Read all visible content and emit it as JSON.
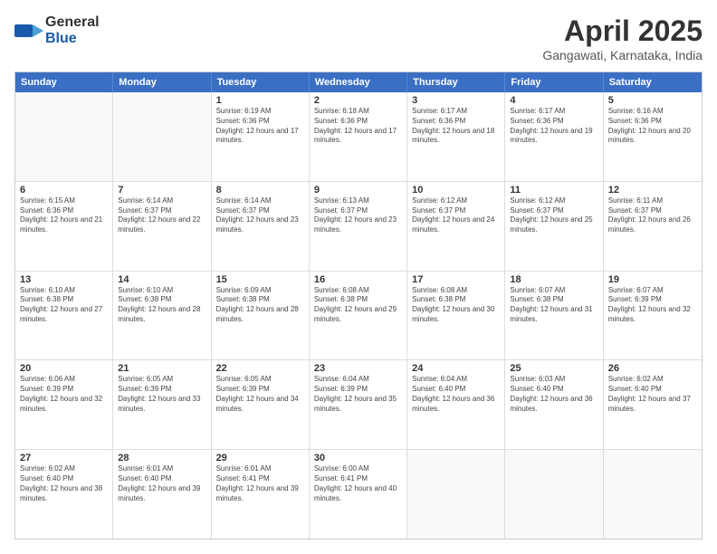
{
  "header": {
    "logo_general": "General",
    "logo_blue": "Blue",
    "month": "April 2025",
    "location": "Gangawati, Karnataka, India"
  },
  "days_of_week": [
    "Sunday",
    "Monday",
    "Tuesday",
    "Wednesday",
    "Thursday",
    "Friday",
    "Saturday"
  ],
  "weeks": [
    [
      {
        "day": "",
        "info": ""
      },
      {
        "day": "",
        "info": ""
      },
      {
        "day": "1",
        "info": "Sunrise: 6:19 AM\nSunset: 6:36 PM\nDaylight: 12 hours and 17 minutes."
      },
      {
        "day": "2",
        "info": "Sunrise: 6:18 AM\nSunset: 6:36 PM\nDaylight: 12 hours and 17 minutes."
      },
      {
        "day": "3",
        "info": "Sunrise: 6:17 AM\nSunset: 6:36 PM\nDaylight: 12 hours and 18 minutes."
      },
      {
        "day": "4",
        "info": "Sunrise: 6:17 AM\nSunset: 6:36 PM\nDaylight: 12 hours and 19 minutes."
      },
      {
        "day": "5",
        "info": "Sunrise: 6:16 AM\nSunset: 6:36 PM\nDaylight: 12 hours and 20 minutes."
      }
    ],
    [
      {
        "day": "6",
        "info": "Sunrise: 6:15 AM\nSunset: 6:36 PM\nDaylight: 12 hours and 21 minutes."
      },
      {
        "day": "7",
        "info": "Sunrise: 6:14 AM\nSunset: 6:37 PM\nDaylight: 12 hours and 22 minutes."
      },
      {
        "day": "8",
        "info": "Sunrise: 6:14 AM\nSunset: 6:37 PM\nDaylight: 12 hours and 23 minutes."
      },
      {
        "day": "9",
        "info": "Sunrise: 6:13 AM\nSunset: 6:37 PM\nDaylight: 12 hours and 23 minutes."
      },
      {
        "day": "10",
        "info": "Sunrise: 6:12 AM\nSunset: 6:37 PM\nDaylight: 12 hours and 24 minutes."
      },
      {
        "day": "11",
        "info": "Sunrise: 6:12 AM\nSunset: 6:37 PM\nDaylight: 12 hours and 25 minutes."
      },
      {
        "day": "12",
        "info": "Sunrise: 6:11 AM\nSunset: 6:37 PM\nDaylight: 12 hours and 26 minutes."
      }
    ],
    [
      {
        "day": "13",
        "info": "Sunrise: 6:10 AM\nSunset: 6:38 PM\nDaylight: 12 hours and 27 minutes."
      },
      {
        "day": "14",
        "info": "Sunrise: 6:10 AM\nSunset: 6:38 PM\nDaylight: 12 hours and 28 minutes."
      },
      {
        "day": "15",
        "info": "Sunrise: 6:09 AM\nSunset: 6:38 PM\nDaylight: 12 hours and 28 minutes."
      },
      {
        "day": "16",
        "info": "Sunrise: 6:08 AM\nSunset: 6:38 PM\nDaylight: 12 hours and 29 minutes."
      },
      {
        "day": "17",
        "info": "Sunrise: 6:08 AM\nSunset: 6:38 PM\nDaylight: 12 hours and 30 minutes."
      },
      {
        "day": "18",
        "info": "Sunrise: 6:07 AM\nSunset: 6:38 PM\nDaylight: 12 hours and 31 minutes."
      },
      {
        "day": "19",
        "info": "Sunrise: 6:07 AM\nSunset: 6:39 PM\nDaylight: 12 hours and 32 minutes."
      }
    ],
    [
      {
        "day": "20",
        "info": "Sunrise: 6:06 AM\nSunset: 6:39 PM\nDaylight: 12 hours and 32 minutes."
      },
      {
        "day": "21",
        "info": "Sunrise: 6:05 AM\nSunset: 6:39 PM\nDaylight: 12 hours and 33 minutes."
      },
      {
        "day": "22",
        "info": "Sunrise: 6:05 AM\nSunset: 6:39 PM\nDaylight: 12 hours and 34 minutes."
      },
      {
        "day": "23",
        "info": "Sunrise: 6:04 AM\nSunset: 6:39 PM\nDaylight: 12 hours and 35 minutes."
      },
      {
        "day": "24",
        "info": "Sunrise: 6:04 AM\nSunset: 6:40 PM\nDaylight: 12 hours and 36 minutes."
      },
      {
        "day": "25",
        "info": "Sunrise: 6:03 AM\nSunset: 6:40 PM\nDaylight: 12 hours and 36 minutes."
      },
      {
        "day": "26",
        "info": "Sunrise: 6:02 AM\nSunset: 6:40 PM\nDaylight: 12 hours and 37 minutes."
      }
    ],
    [
      {
        "day": "27",
        "info": "Sunrise: 6:02 AM\nSunset: 6:40 PM\nDaylight: 12 hours and 38 minutes."
      },
      {
        "day": "28",
        "info": "Sunrise: 6:01 AM\nSunset: 6:40 PM\nDaylight: 12 hours and 39 minutes."
      },
      {
        "day": "29",
        "info": "Sunrise: 6:01 AM\nSunset: 6:41 PM\nDaylight: 12 hours and 39 minutes."
      },
      {
        "day": "30",
        "info": "Sunrise: 6:00 AM\nSunset: 6:41 PM\nDaylight: 12 hours and 40 minutes."
      },
      {
        "day": "",
        "info": ""
      },
      {
        "day": "",
        "info": ""
      },
      {
        "day": "",
        "info": ""
      }
    ]
  ]
}
